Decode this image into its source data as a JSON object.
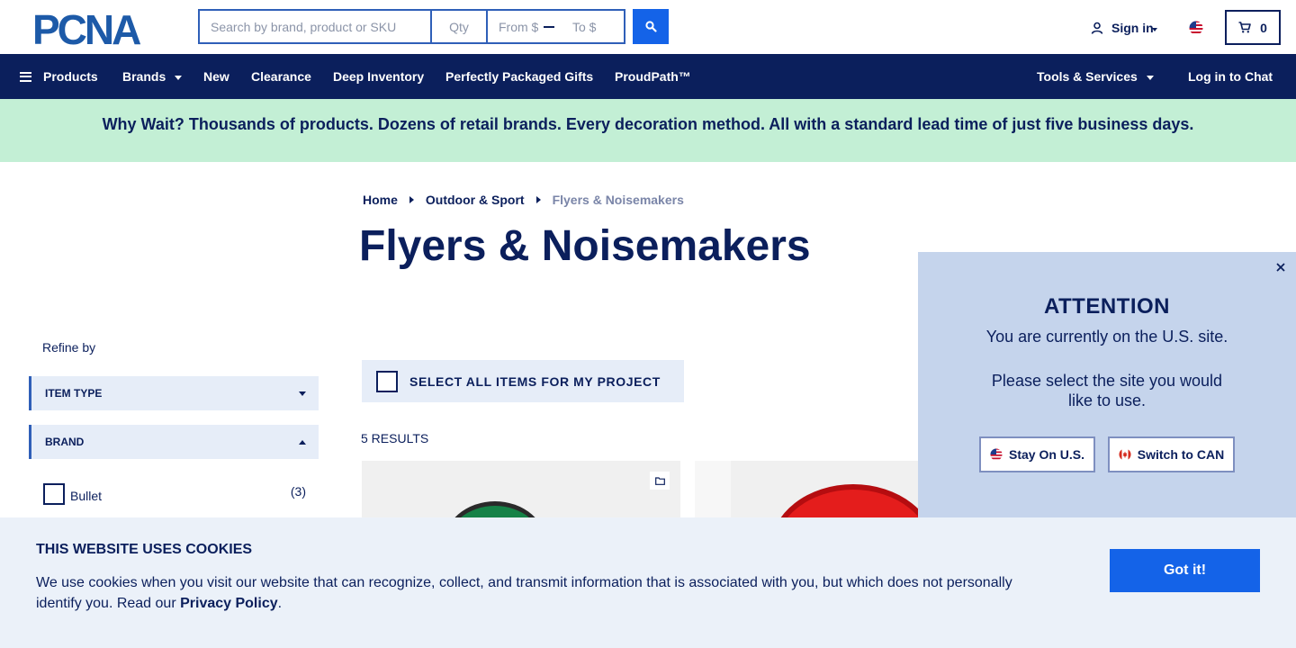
{
  "header": {
    "logo_text": "PCNA",
    "search": {
      "placeholder": "Search by brand, product or SKU"
    },
    "qty": {
      "placeholder": "Qty"
    },
    "price_from": {
      "placeholder": "From $"
    },
    "price_to": {
      "placeholder": "To $"
    },
    "signin_label": "Sign in",
    "cart_count": "0"
  },
  "nav": {
    "items": [
      {
        "label": "Products"
      },
      {
        "label": "Brands"
      },
      {
        "label": "New"
      },
      {
        "label": "Clearance"
      },
      {
        "label": "Deep Inventory"
      },
      {
        "label": "Perfectly Packaged Gifts"
      },
      {
        "label": "ProudPath™"
      },
      {
        "label": "Tools & Services"
      },
      {
        "label": "Log in to Chat"
      }
    ]
  },
  "promo": {
    "text": "Why Wait? Thousands of products. Dozens of retail brands. Every decoration method. All with a standard lead time of just five business days."
  },
  "breadcrumb": {
    "home": "Home",
    "category": "Outdoor & Sport",
    "current": "Flyers & Noisemakers"
  },
  "page_title": "Flyers & Noisemakers",
  "sidebar": {
    "refine_label": "Refine by",
    "facets": [
      {
        "label": "ITEM TYPE",
        "expanded": false
      },
      {
        "label": "BRAND",
        "expanded": true
      }
    ],
    "brand_options": [
      {
        "label": "Bullet",
        "count": "(3)"
      }
    ]
  },
  "main": {
    "select_all_label": "SELECT ALL ITEMS FOR MY PROJECT",
    "results_count": "5 RESULTS"
  },
  "attention": {
    "title": "ATTENTION",
    "message1": "You are currently on the U.S. site.",
    "message2": "Please select the site you would like to use.",
    "stay_label": "Stay On U.S.",
    "switch_label": "Switch to CAN"
  },
  "cookie": {
    "title": "THIS WEBSITE USES COOKIES",
    "text": "We use cookies when you visit our website that can recognize, collect, and transmit information that is associated with you, but which does not personally identify you. Read our ",
    "link": "Privacy Policy",
    "text_end": ".",
    "button": "Got it!"
  },
  "colors": {
    "navy": "#0b1f5c",
    "accent_blue": "#1463e8",
    "promo_green": "#c3efd5",
    "facet_bg": "#e6edf8",
    "attention_bg": "#c5d4ec",
    "cookie_bg": "#ebf1f9"
  },
  "icons": [
    "search-icon",
    "user-icon",
    "us-flag-icon",
    "cart-icon",
    "menu-icon",
    "caret-down-icon",
    "close-icon",
    "folder-icon",
    "canada-flag-icon"
  ]
}
